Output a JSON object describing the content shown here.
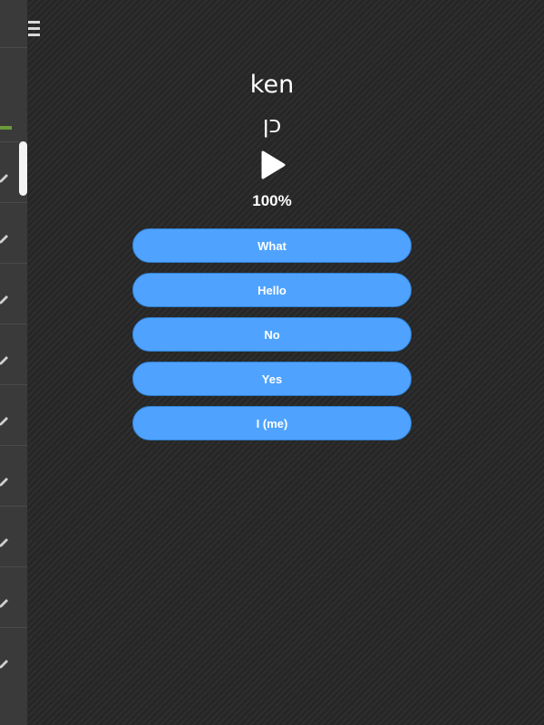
{
  "quiz": {
    "word": "ken",
    "translation": "כן",
    "play_icon": "play-icon",
    "progress_text": "100%",
    "answers": [
      {
        "label": "What"
      },
      {
        "label": "Hello"
      },
      {
        "label": "No"
      },
      {
        "label": "Yes"
      },
      {
        "label": "I (me)"
      }
    ]
  },
  "sidebar": {
    "menu_icon": "hamburger-menu-icon",
    "row_icon": "pencil-icon",
    "row_count": 9
  },
  "colors": {
    "background": "#2b2b2b",
    "sidebar": "#3a3a3a",
    "answer_button": "#4fa3ff",
    "progress_accent": "#6a9a3a",
    "text": "#ffffff"
  }
}
